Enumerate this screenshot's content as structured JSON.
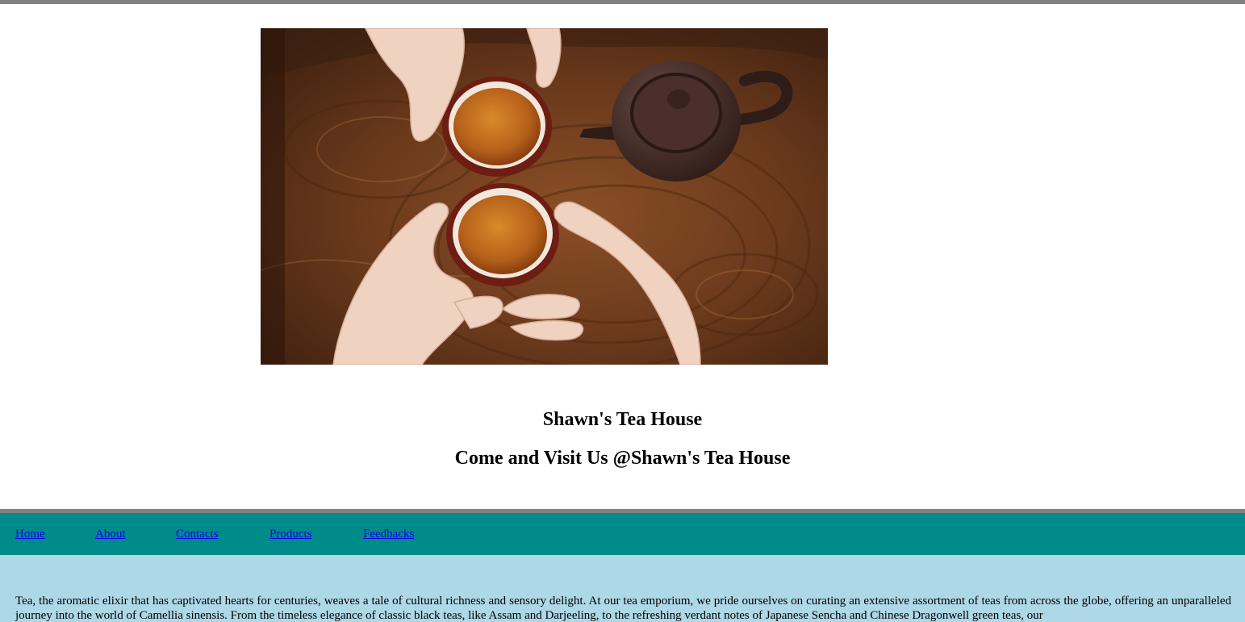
{
  "hero": {
    "image_alt": "Two hands holding cups of tea beside a clay teapot on a wooden table"
  },
  "header": {
    "title": "Shawn's Tea House",
    "subtitle": "Come and Visit Us @Shawn's Tea House"
  },
  "nav": {
    "items": [
      {
        "label": "Home"
      },
      {
        "label": "About"
      },
      {
        "label": "Contacts"
      },
      {
        "label": "Products"
      },
      {
        "label": "Feedbacks"
      }
    ]
  },
  "main": {
    "intro": "Tea, the aromatic elixir that has captivated hearts for centuries, weaves a tale of cultural richness and sensory delight. At our tea emporium, we pride ourselves on curating an extensive assortment of teas from across the globe, offering an unparalleled journey into the world of Camellia sinensis. From the timeless elegance of classic black teas, like Assam and Darjeeling, to the refreshing verdant notes of Japanese Sencha and Chinese Dragonwell green teas, our"
  },
  "colors": {
    "rule": "#808080",
    "nav_background": "#008b8b",
    "content_background": "#add8e6",
    "link": "#0000ee"
  }
}
